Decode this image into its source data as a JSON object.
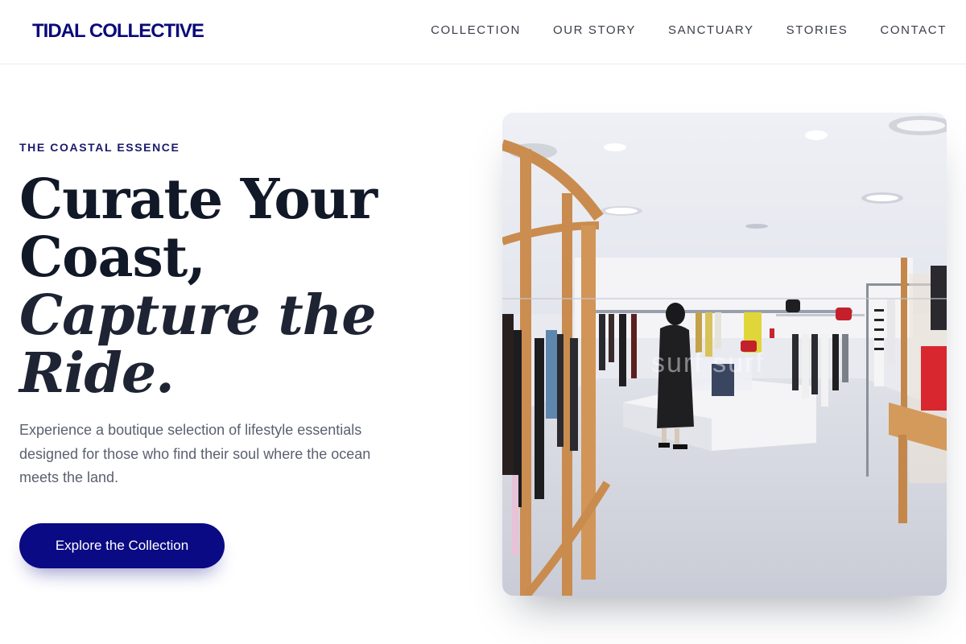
{
  "brand": {
    "name": "TIDAL COLLECTIVE"
  },
  "nav": {
    "items": [
      {
        "label": "COLLECTION"
      },
      {
        "label": "OUR STORY"
      },
      {
        "label": "SANCTUARY"
      },
      {
        "label": "STORIES"
      },
      {
        "label": "CONTACT"
      }
    ]
  },
  "hero": {
    "eyebrow": "THE COASTAL ESSENCE",
    "headline": {
      "line1": "Curate Your",
      "line2": "Coast,",
      "line3": "Capture the",
      "line4": "Ride."
    },
    "description": "Experience a boutique selection of lifestyle essentials designed for those who find their soul where the ocean meets the land.",
    "cta_label": "Explore the Collection",
    "image_watermark": "surf surf"
  },
  "colors": {
    "brand": "#0a0a7a",
    "cta_background": "#0a0a84",
    "headline": "#111827",
    "body_text": "#5b6070"
  }
}
